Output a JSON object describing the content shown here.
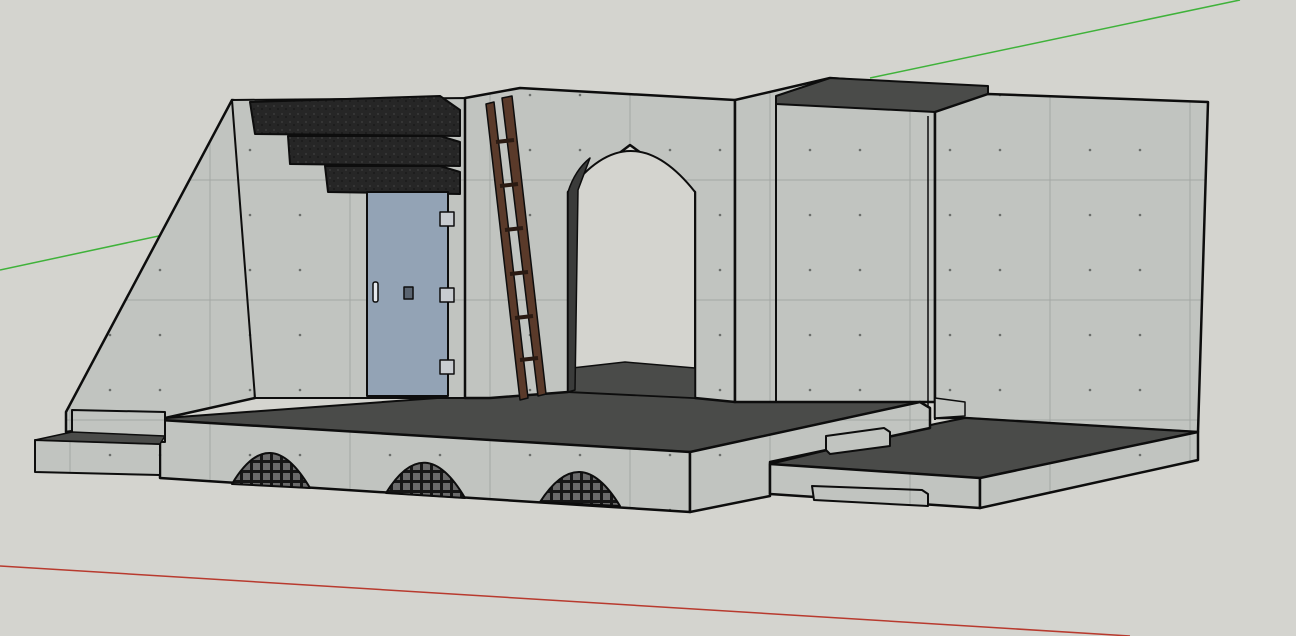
{
  "viewport": {
    "background": "#d4d4cf",
    "axes": {
      "green_axis_color": "#3fb23a",
      "red_axis_color": "#b83a2e"
    }
  },
  "model": {
    "concrete_color": "#bfc3bf",
    "concrete_shade_color": "#a9aca9",
    "floor_color": "#4a4b49",
    "edge_color": "#0d0d0d",
    "door_color": "#93a3b5",
    "ladder_color": "#5a3a2a",
    "dark_stone_color": "#262626",
    "grate_color": "#1a1a1a"
  }
}
